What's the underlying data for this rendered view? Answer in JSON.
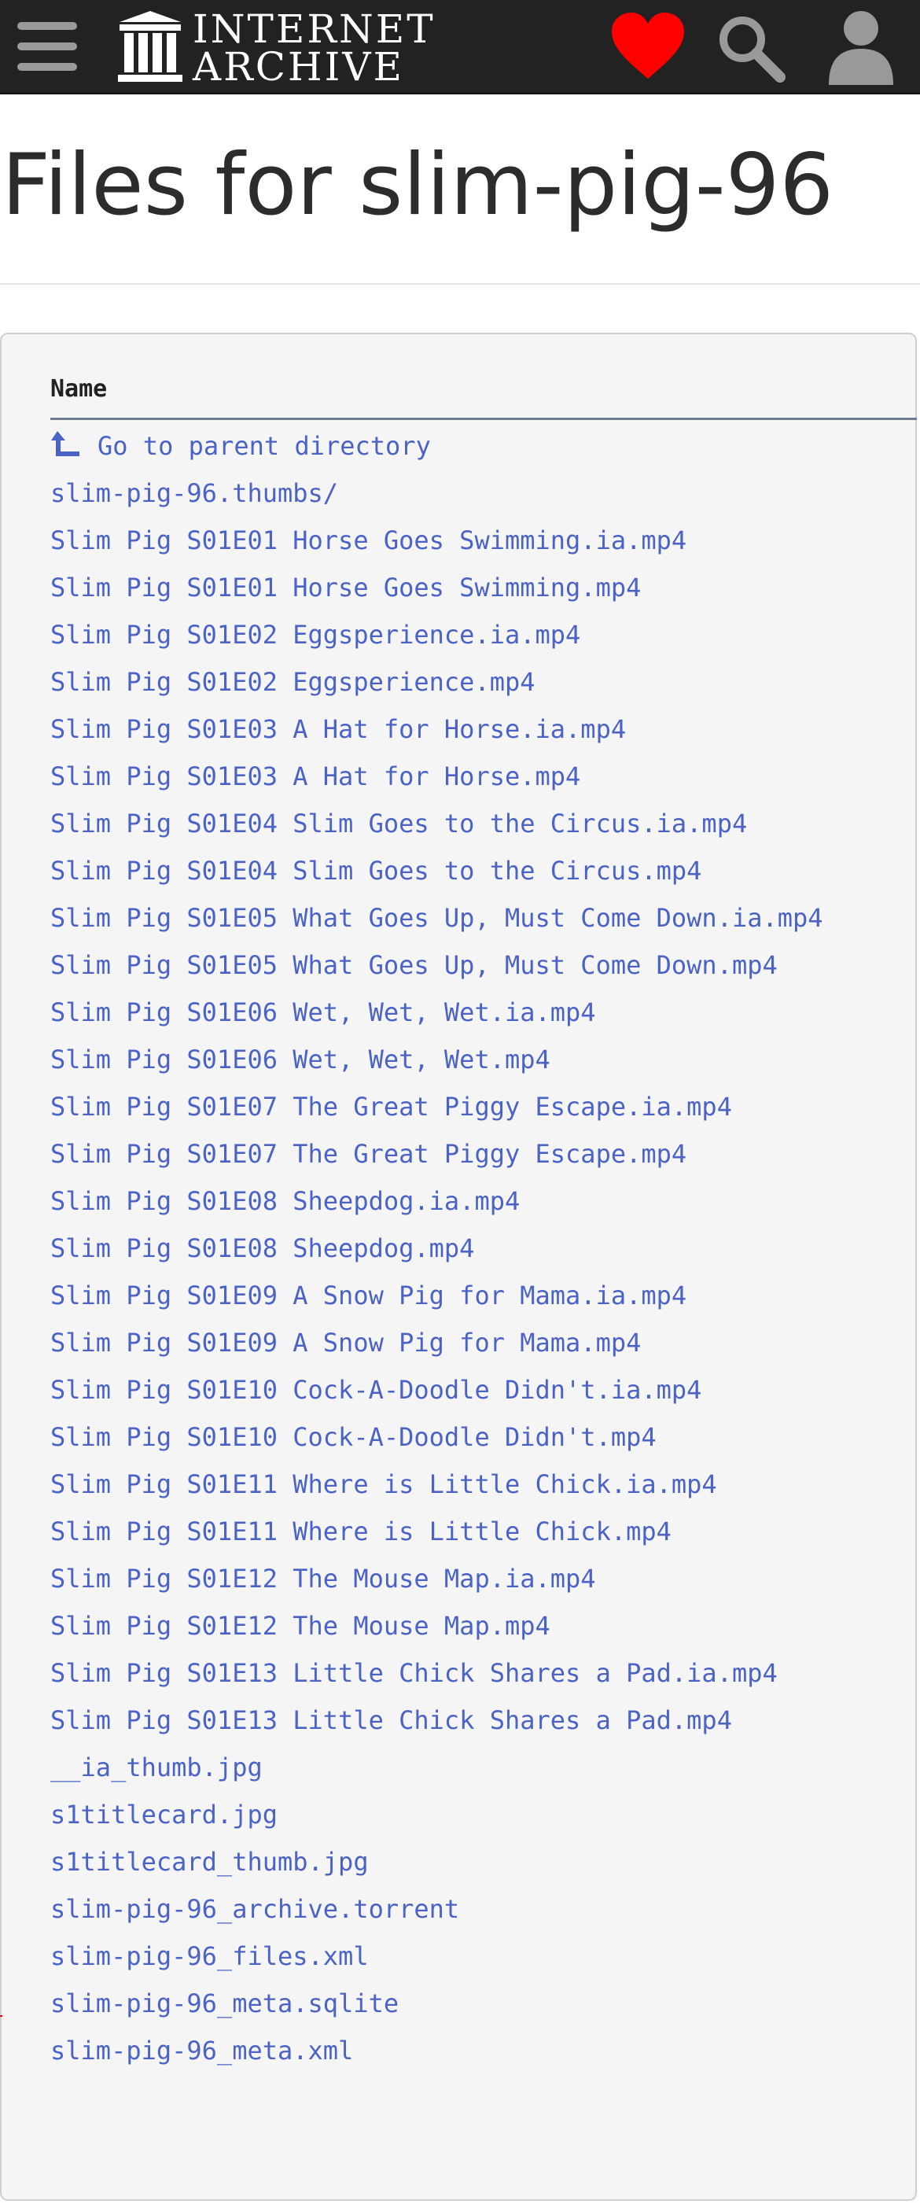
{
  "header": {
    "logo_line1": "INTERNET",
    "logo_line2": "ARCHIVE",
    "icons": {
      "menu": "hamburger-menu-icon",
      "logo": "archive-building-icon",
      "donate": "heart-icon",
      "search": "search-icon",
      "account": "user-icon"
    },
    "colors": {
      "bar": "#222222",
      "heart": "#ff0000",
      "icon_gray": "#999999"
    }
  },
  "title": "Files for slim-pig-96",
  "listing": {
    "column_header": "Name",
    "parent_link": "Go to parent directory",
    "link_color": "#4b63c7",
    "files": [
      "slim-pig-96.thumbs/",
      "Slim Pig S01E01 Horse Goes Swimming.ia.mp4",
      "Slim Pig S01E01 Horse Goes Swimming.mp4",
      "Slim Pig S01E02 Eggsperience.ia.mp4",
      "Slim Pig S01E02 Eggsperience.mp4",
      "Slim Pig S01E03 A Hat for Horse.ia.mp4",
      "Slim Pig S01E03 A Hat for Horse.mp4",
      "Slim Pig S01E04 Slim Goes to the Circus.ia.mp4",
      "Slim Pig S01E04 Slim Goes to the Circus.mp4",
      "Slim Pig S01E05 What Goes Up, Must Come Down.ia.mp4",
      "Slim Pig S01E05 What Goes Up, Must Come Down.mp4",
      "Slim Pig S01E06 Wet, Wet, Wet.ia.mp4",
      "Slim Pig S01E06 Wet, Wet, Wet.mp4",
      "Slim Pig S01E07 The Great Piggy Escape.ia.mp4",
      "Slim Pig S01E07 The Great Piggy Escape.mp4",
      "Slim Pig S01E08 Sheepdog.ia.mp4",
      "Slim Pig S01E08 Sheepdog.mp4",
      "Slim Pig S01E09 A Snow Pig for Mama.ia.mp4",
      "Slim Pig S01E09 A Snow Pig for Mama.mp4",
      "Slim Pig S01E10 Cock-A-Doodle Didn't.ia.mp4",
      "Slim Pig S01E10 Cock-A-Doodle Didn't.mp4",
      "Slim Pig S01E11 Where is Little Chick.ia.mp4",
      "Slim Pig S01E11 Where is Little Chick.mp4",
      "Slim Pig S01E12 The Mouse Map.ia.mp4",
      "Slim Pig S01E12 The Mouse Map.mp4",
      "Slim Pig S01E13 Little Chick Shares a Pad.ia.mp4",
      "Slim Pig S01E13 Little Chick Shares a Pad.mp4",
      "__ia_thumb.jpg",
      "s1titlecard.jpg",
      "s1titlecard_thumb.jpg",
      "slim-pig-96_archive.torrent",
      "slim-pig-96_files.xml",
      "slim-pig-96_meta.sqlite",
      "slim-pig-96_meta.xml"
    ]
  }
}
